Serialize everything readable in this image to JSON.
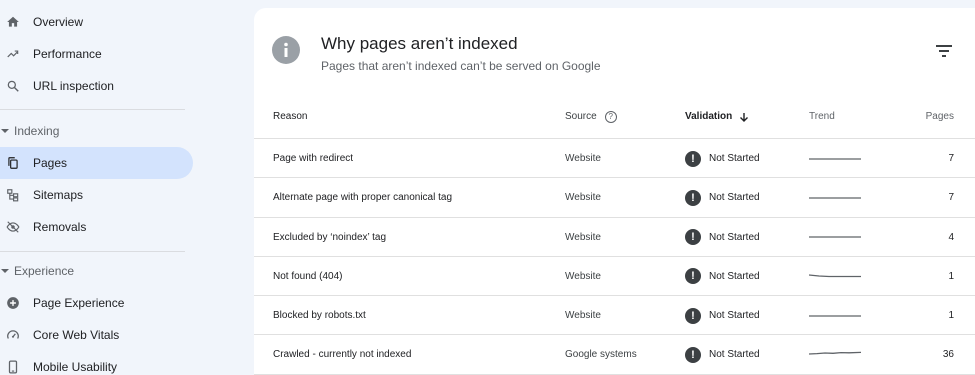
{
  "sidebar": {
    "items_top": [
      {
        "label": "Overview",
        "icon": "home-icon"
      },
      {
        "label": "Performance",
        "icon": "trending-up-icon"
      },
      {
        "label": "URL inspection",
        "icon": "search-icon"
      }
    ],
    "indexing": {
      "label": "Indexing",
      "items": [
        {
          "label": "Pages",
          "icon": "pages-icon",
          "active": true
        },
        {
          "label": "Sitemaps",
          "icon": "sitemap-icon"
        },
        {
          "label": "Removals",
          "icon": "eye-off-icon"
        }
      ]
    },
    "experience": {
      "label": "Experience",
      "items": [
        {
          "label": "Page Experience",
          "icon": "plus-circle-icon"
        },
        {
          "label": "Core Web Vitals",
          "icon": "gauge-icon"
        },
        {
          "label": "Mobile Usability",
          "icon": "phone-icon"
        }
      ]
    }
  },
  "card": {
    "title": "Why pages aren’t indexed",
    "subtitle": "Pages that aren’t indexed can’t be served on Google",
    "columns": {
      "reason": "Reason",
      "source": "Source",
      "validation": "Validation",
      "trend": "Trend",
      "pages": "Pages"
    },
    "rows": [
      {
        "reason": "Page with redirect",
        "source": "Website",
        "validation": "Not Started",
        "pages": "7"
      },
      {
        "reason": "Alternate page with proper canonical tag",
        "source": "Website",
        "validation": "Not Started",
        "pages": "7"
      },
      {
        "reason": "Excluded by ‘noindex’ tag",
        "source": "Website",
        "validation": "Not Started",
        "pages": "4"
      },
      {
        "reason": "Not found (404)",
        "source": "Website",
        "validation": "Not Started",
        "pages": "1"
      },
      {
        "reason": "Blocked by robots.txt",
        "source": "Website",
        "validation": "Not Started",
        "pages": "1"
      },
      {
        "reason": "Crawled - currently not indexed",
        "source": "Google systems",
        "validation": "Not Started",
        "pages": "36"
      }
    ]
  },
  "colors": {
    "active_nav": "#d3e3fd",
    "background": "#f1f5fb",
    "warning": "#3c4043"
  }
}
